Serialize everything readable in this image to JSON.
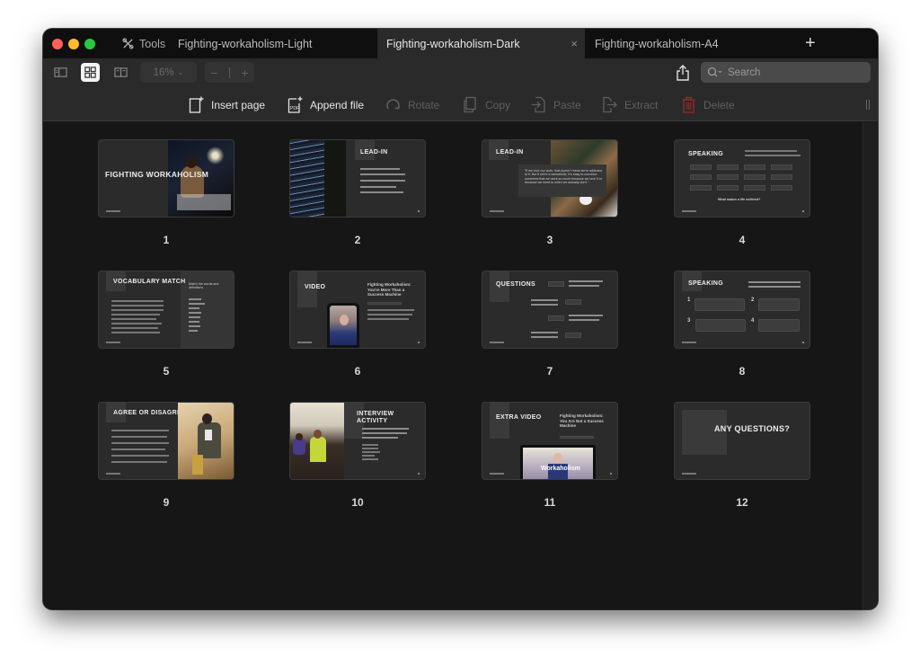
{
  "window": {
    "tabs_bar": {
      "tools_label": "Tools",
      "tabs": [
        {
          "label": "Fighting-workaholism-Light",
          "active": false
        },
        {
          "label": "Fighting-workaholism-Dark",
          "active": true
        },
        {
          "label": "Fighting-workaholism-A4",
          "active": false
        }
      ],
      "new_tab_icon": "plus-icon",
      "close_icon": "×"
    },
    "toolbar": {
      "view_modes": [
        "sidebar-view",
        "grid-view",
        "two-page-view"
      ],
      "active_view": "grid-view",
      "zoom_level": "16%",
      "zoom_out": "−",
      "zoom_in": "+",
      "search_placeholder": "Search"
    },
    "actions": {
      "insert_page": "Insert page",
      "append_file": "Append file",
      "rotate": "Rotate",
      "copy": "Copy",
      "paste": "Paste",
      "extract": "Extract",
      "delete": "Delete"
    },
    "colors": {
      "delete_icon": "#8e2a2a",
      "active_view_bg": "#f4f4f4",
      "window_bg": "#161616",
      "toolbar_bg": "#2a2a2a"
    }
  },
  "pages": [
    {
      "number": "1",
      "title": "FIGHTING WORKAHOLISM"
    },
    {
      "number": "2",
      "title": "LEAD-IN"
    },
    {
      "number": "3",
      "title": "LEAD-IN",
      "quote": "\"If we love our work, that doesn't mean we're addicted to it. But if we're a workaholic, it's easy to convince ourselves that we work so much because we love it or because we need to when we actually don't.\""
    },
    {
      "number": "4",
      "title": "SPEAKING",
      "footer": "What makes a life wellived?"
    },
    {
      "number": "5",
      "title": "VOCABULARY MATCH",
      "subtitle": "Match the words and definitions"
    },
    {
      "number": "6",
      "title": "VIDEO",
      "heading": "Fighting Workaholism: You're More Than a Success Machine"
    },
    {
      "number": "7",
      "title": "QUESTIONS"
    },
    {
      "number": "8",
      "title": "SPEAKING"
    },
    {
      "number": "9",
      "title": "AGREE OR DISAGREE"
    },
    {
      "number": "10",
      "title": "INTERVIEW ACTIVITY"
    },
    {
      "number": "11",
      "title": "EXTRA VIDEO",
      "heading": "Fighting Workaholism: You Are Not a Success Machine",
      "video_caption": "Workaholism"
    },
    {
      "number": "12",
      "title": "ANY QUESTIONS?"
    }
  ]
}
